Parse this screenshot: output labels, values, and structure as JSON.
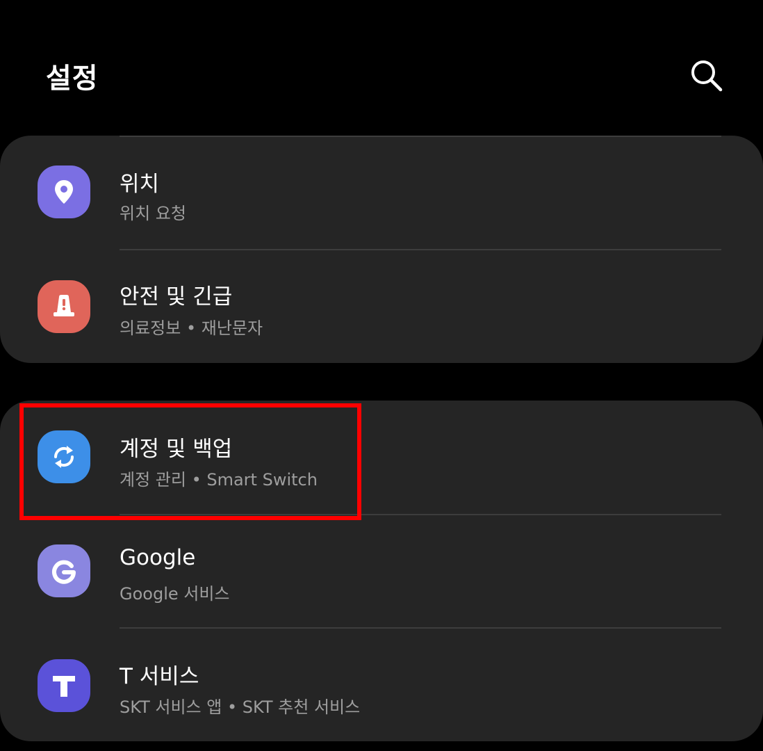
{
  "header": {
    "title": "설정",
    "search_icon": "search-icon"
  },
  "colors": {
    "background": "#000000",
    "card": "#252525",
    "divider": "#3d3d3d",
    "subtitle": "#9e9e9e",
    "highlight": "#ff0000",
    "location_icon_bg": "#7b6fe3",
    "safety_icon_bg": "#e0655a",
    "accounts_icon_bg": "#3d8fe8",
    "google_icon_bg": "#8a86e0",
    "tservice_icon_bg": "#5b52d9"
  },
  "groups": [
    {
      "items": [
        {
          "title": "위치",
          "subtitle": "위치 요청",
          "icon": "location-pin-icon"
        },
        {
          "title": "안전 및 긴급",
          "subtitle": "의료정보 • 재난문자",
          "icon": "alert-siren-icon"
        }
      ]
    },
    {
      "items": [
        {
          "title": "계정 및 백업",
          "subtitle": "계정 관리 • Smart Switch",
          "icon": "sync-icon",
          "highlighted": true
        },
        {
          "title": "Google",
          "subtitle": "Google 서비스",
          "icon": "google-icon"
        },
        {
          "title": "T 서비스",
          "subtitle": "SKT 서비스 앱 • SKT 추천 서비스",
          "icon": "t-service-icon"
        }
      ]
    }
  ]
}
